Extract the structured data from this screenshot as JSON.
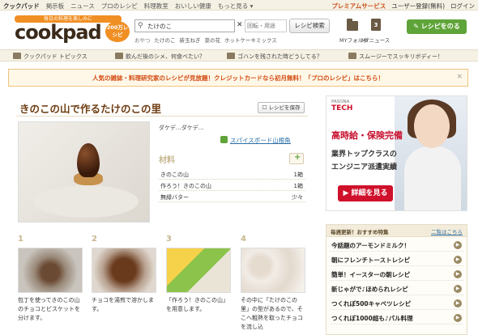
{
  "topnav": {
    "links": [
      "クックパッド",
      "掲示板",
      "ニュース",
      "プロのレシピ",
      "料理教室",
      "おいしい健康",
      "もっと見る ▾"
    ],
    "premium": "プレミアムサービス",
    "register": "ユーザー登録(無料)",
    "login": "ログイン"
  },
  "header": {
    "logo_tagline": "毎日の料理を楽しみに",
    "logo_text": "cookpad",
    "logo_badge": "200万レシピ",
    "search_value": "たけのこ",
    "exclude_placeholder": "回転・用途",
    "search_button": "レシピ検索",
    "suggest_label": "おやつ",
    "suggest": [
      "たけのこ",
      "新玉ねぎ",
      "菜の花",
      "ホットケーキミックス"
    ],
    "myfolder": "MYフォルダ",
    "mynews": "MYニュース",
    "news_badge": "3",
    "post_button": "レシピをのる"
  },
  "topics": [
    "クックパッド トピックス",
    "飲んだ後のシメ、何食べたい？",
    "ゴハンを残された時どうしてる？",
    "スムージーでスッキリボディー！"
  ],
  "promo": {
    "message": "人気の雑誌・料理研究家のレシピが見放題！クレジットカードなら初月無料！「プロのレシピ」はこちら！",
    "close": "×"
  },
  "recipe": {
    "title": "きのこの山で作るたけのこの里",
    "save_button": "レシピを保存",
    "description": "ダケデ…ダケデ…",
    "author": "スパイスボード山根魚",
    "ingredients_heading": "材料",
    "ingredients": [
      {
        "name": "きのこの山",
        "qty": "1箱"
      },
      {
        "name": "作ろう！きのこの山",
        "qty": "1箱"
      },
      {
        "name": "無緑バター",
        "qty": "少々"
      }
    ]
  },
  "steps": [
    {
      "num": "1",
      "text": "包丁を使ってきのこの山のチョコとビスケットを分けます。"
    },
    {
      "num": "2",
      "text": "チョコを湯煎で溶かします。"
    },
    {
      "num": "3",
      "text": "「作ろう！きのこの山」を用意します。"
    },
    {
      "num": "4",
      "text": "その中に「たけのこの里」の型があるので、そこへ粗熱を取ったチョコを流し込"
    }
  ],
  "ad": {
    "brand_small": "PASONA",
    "brand": "TECH",
    "headline": "高時給・保険完備",
    "line1": "業界トップクラスの",
    "line2": "エンジニア派遣実績",
    "cta": "詳細を見る"
  },
  "feature": {
    "heading": "毎週更新！おすすめ特集",
    "more": "二覧はこちら",
    "items": [
      "今話題のアーモンドミルク！",
      "朝にフレンチトーストレシピ",
      "簡単！イースターの朝レシピ",
      "新じゃがで♪ほめられレシピ",
      "つくれぽ500キャベツレシピ",
      "つくれぽ1000超も♪パル料理"
    ]
  },
  "colors": {
    "brand_orange": "#f08f24",
    "post_green": "#5fa438",
    "title_brown": "#6e3d12",
    "promo_red": "#d24a12",
    "ad_red": "#d0112b"
  }
}
